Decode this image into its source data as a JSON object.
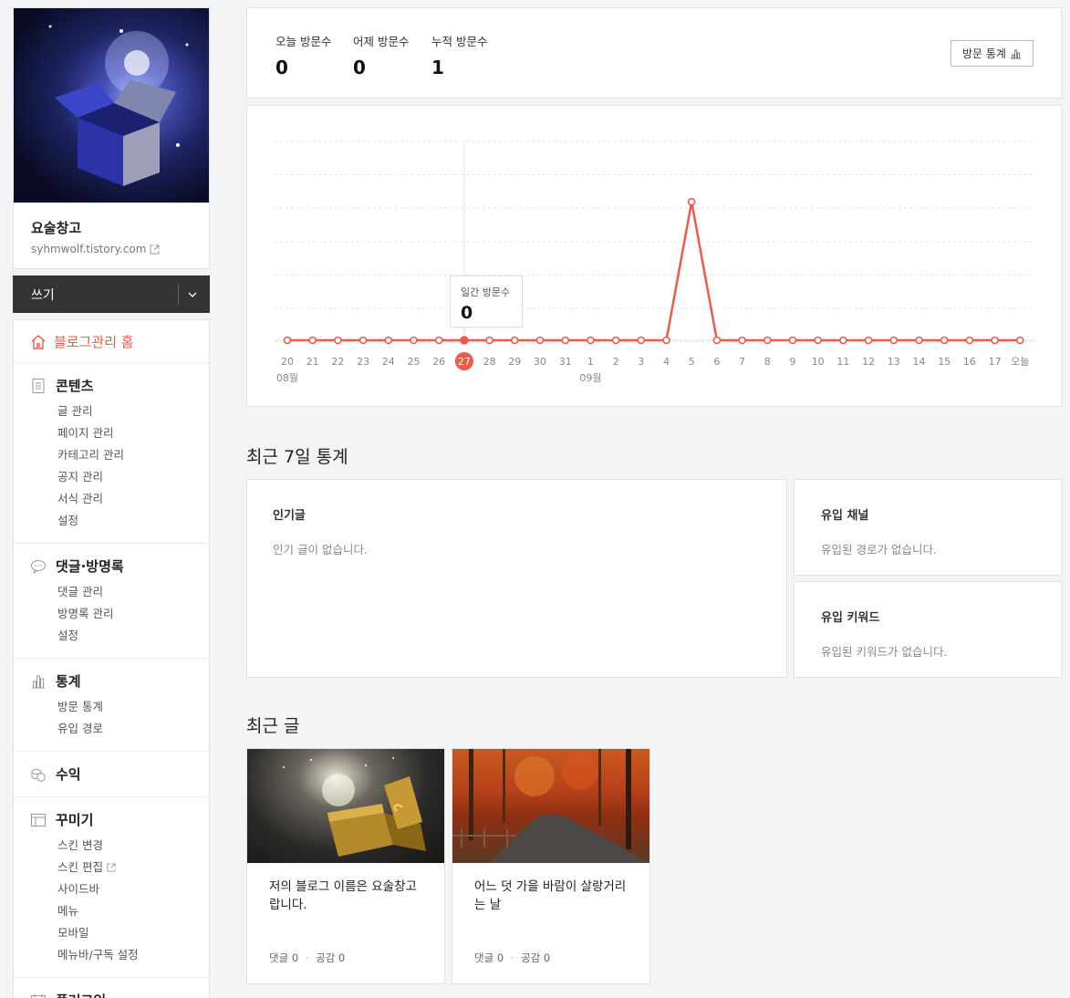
{
  "profile": {
    "blog_name": "요술창고",
    "blog_url": "syhmwolf.tistory.com"
  },
  "write": {
    "label": "쓰기"
  },
  "menu": {
    "home": "블로그관리 홈",
    "content": {
      "title": "콘텐츠",
      "items": [
        "글 관리",
        "페이지 관리",
        "카테고리 관리",
        "공지 관리",
        "서식 관리",
        "설정"
      ]
    },
    "comments": {
      "title": "댓글·방명록",
      "items": [
        "댓글 관리",
        "방명록 관리",
        "설정"
      ]
    },
    "stats": {
      "title": "통계",
      "items": [
        "방문 통계",
        "유입 경로"
      ]
    },
    "revenue": {
      "title": "수익"
    },
    "decorate": {
      "title": "꾸미기",
      "items": [
        "스킨 변경",
        "스킨 편집",
        "사이드바",
        "메뉴",
        "모바일",
        "메뉴바/구독 설정"
      ]
    },
    "plugin": {
      "title": "플러그인"
    }
  },
  "visits": {
    "today_label": "오늘 방문수",
    "today_value": "0",
    "yesterday_label": "어제 방문수",
    "yesterday_value": "0",
    "total_label": "누적 방문수",
    "total_value": "1",
    "button_label": "방문 통계"
  },
  "tooltip": {
    "label": "일간 방문수",
    "value": "0"
  },
  "colors": {
    "accent": "#f15a4a"
  },
  "chart_data": {
    "type": "line",
    "categories": [
      "20",
      "21",
      "22",
      "23",
      "24",
      "25",
      "26",
      "27",
      "28",
      "29",
      "30",
      "31",
      "1",
      "2",
      "3",
      "4",
      "5",
      "6",
      "7",
      "8",
      "9",
      "10",
      "11",
      "12",
      "13",
      "14",
      "15",
      "16",
      "17",
      "오늘"
    ],
    "values": [
      0,
      0,
      0,
      0,
      0,
      0,
      0,
      0,
      0,
      0,
      0,
      0,
      0,
      0,
      0,
      0,
      1,
      0,
      0,
      0,
      0,
      0,
      0,
      0,
      0,
      0,
      0,
      0,
      0,
      0
    ],
    "month_labels": [
      {
        "index": 0,
        "label": "08월"
      },
      {
        "index": 12,
        "label": "09월"
      }
    ],
    "highlight_index": 7,
    "ylim": [
      0,
      1.2
    ],
    "grid": true
  },
  "recent7": {
    "title": "최근 7일 통계",
    "popular_title": "인기글",
    "popular_empty": "인기 글이 없습니다.",
    "channel_title": "유입 채널",
    "channel_empty": "유입된 경로가 없습니다.",
    "keyword_title": "유입 키워드",
    "keyword_empty": "유입된 키워드가 없습니다."
  },
  "recent_posts": {
    "title": "최근 글",
    "posts": [
      {
        "title": "저의 블로그 이름은 요술창고랍니다.",
        "meta_comments": "댓글 0",
        "meta_likes": "공감 0"
      },
      {
        "title": "어느 덧 가을 바람이 살랑거리는 날",
        "meta_comments": "댓글 0",
        "meta_likes": "공감 0"
      }
    ]
  }
}
